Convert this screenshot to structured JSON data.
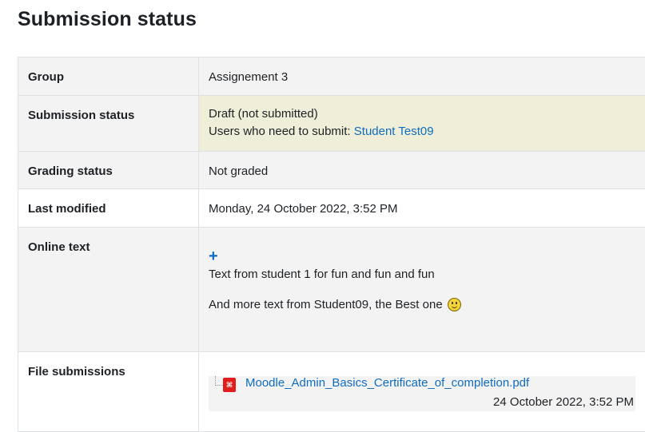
{
  "page_title": "Submission status",
  "rows": {
    "group": {
      "label": "Group",
      "value": "Assignement 3"
    },
    "submission_status": {
      "label": "Submission status",
      "value": "Draft (not submitted)",
      "users_prefix": "Users who need to submit: ",
      "user_link": "Student Test09"
    },
    "grading_status": {
      "label": "Grading status",
      "value": "Not graded"
    },
    "last_modified": {
      "label": "Last modified",
      "value": "Monday, 24 October 2022, 3:52 PM"
    },
    "online_text": {
      "label": "Online text",
      "expand_icon": "+",
      "line1": "Text from student 1 for fun and fun and fun",
      "line2": "And more text from Student09, the Best one "
    },
    "file_submissions": {
      "label": "File submissions",
      "file_name": "Moodle_Admin_Basics_Certificate_of_completion.pdf",
      "file_date": "24 October 2022, 3:52 PM",
      "file_icon": "pdf-icon"
    }
  },
  "colors": {
    "link": "#0f6cbf",
    "draft_highlight": "#efefd9",
    "row_shade": "#f3f3f3"
  }
}
